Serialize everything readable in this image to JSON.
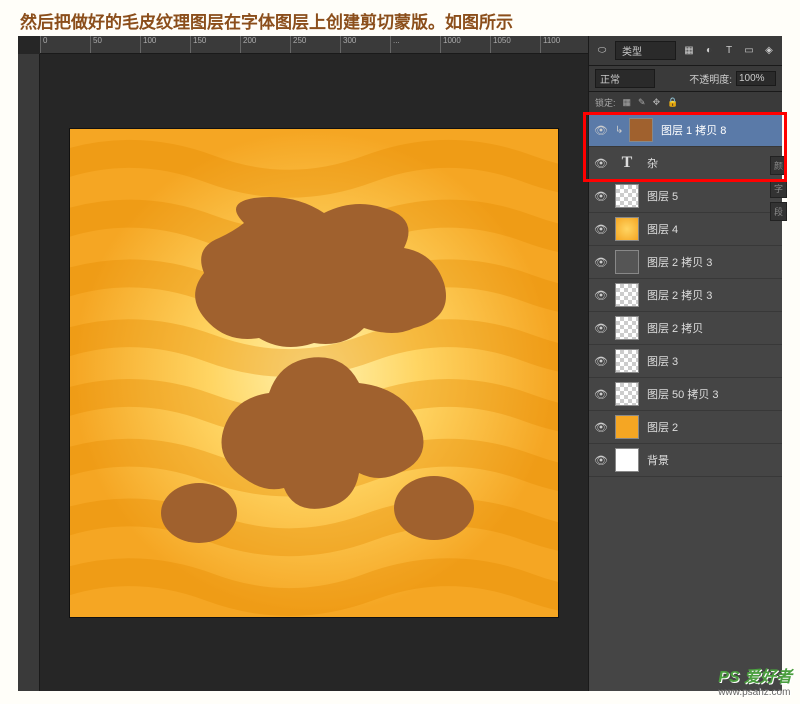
{
  "instruction": "然后把做好的毛皮纹理图层在字体图层上创建剪切蒙版。如图所示",
  "ruler_marks": [
    "0",
    "50",
    "100",
    "150",
    "200",
    "250",
    "300",
    "...",
    "1000",
    "1050",
    "1100"
  ],
  "panel": {
    "type_label": "类型",
    "blend_mode": "正常",
    "opacity_label": "不透明度:",
    "opacity_value": "100%",
    "lock_label": "锁定:"
  },
  "layers": [
    {
      "name": "图层 1 拷贝 8",
      "thumb": "texture",
      "selected": true,
      "indented": true
    },
    {
      "name": "杂",
      "thumb": "type",
      "selected": false,
      "indented": false
    },
    {
      "name": "图层 5",
      "thumb": "trans",
      "selected": false,
      "indented": false
    },
    {
      "name": "图层 4",
      "thumb": "sun",
      "selected": false,
      "indented": false
    },
    {
      "name": "图层 2 拷贝 3",
      "thumb": "gray",
      "selected": false,
      "indented": false
    },
    {
      "name": "图层 2 拷贝 3",
      "thumb": "trans",
      "selected": false,
      "indented": false
    },
    {
      "name": "图层 2 拷贝",
      "thumb": "trans",
      "selected": false,
      "indented": false
    },
    {
      "name": "图层 3",
      "thumb": "trans",
      "selected": false,
      "indented": false
    },
    {
      "name": "图层 50 拷贝 3",
      "thumb": "trans",
      "selected": false,
      "indented": false
    },
    {
      "name": "图层 2",
      "thumb": "orangesolid",
      "selected": false,
      "indented": false
    },
    {
      "name": "背景",
      "thumb": "white",
      "selected": false,
      "indented": false
    }
  ],
  "watermark": {
    "main": "PS 爱好者",
    "sub": "www.psahz.com"
  },
  "side_labels": [
    "颜",
    "字",
    "段"
  ]
}
